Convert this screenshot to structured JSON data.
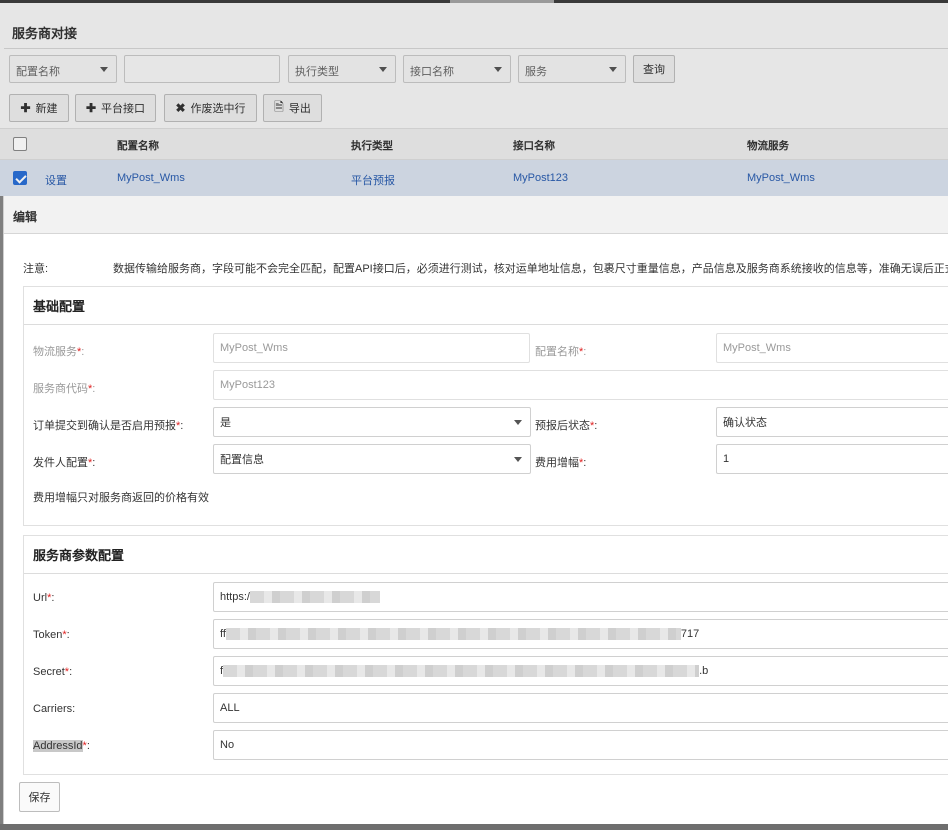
{
  "page": {
    "title": "服务商对接",
    "filters": {
      "config_name": "配置名称",
      "exec_type": "执行类型",
      "api_name": "接口名称",
      "service": "服务",
      "search_value": "",
      "query_label": "查询"
    },
    "toolbar": {
      "new_label": "新建",
      "platform_label": "平台接口",
      "void_label": "作废选中行",
      "export_label": "导出"
    },
    "table": {
      "headers": [
        "配置名称",
        "执行类型",
        "接口名称",
        "物流服务"
      ],
      "rows": [
        {
          "action": "设置",
          "config_name": "MyPost_Wms",
          "exec_type": "平台预报",
          "api_name": "MyPost123",
          "service": "MyPost_Wms"
        }
      ]
    }
  },
  "modal": {
    "title": "编辑",
    "notice_label": "注意:",
    "notice_text": "数据传输给服务商，字段可能不会完全匹配，配置API接口后，必须进行测试，核对运单地址信息，包裹尺寸重量信息，产品信息及服务商系统接收的信息等，准确无误后正式使",
    "basic": {
      "title": "基础配置",
      "logistics_service_label": "物流服务",
      "logistics_service_value": "MyPost_Wms",
      "config_name_label": "配置名称",
      "config_name_value": "MyPost_Wms",
      "provider_code_label": "服务商代码",
      "provider_code_value": "MyPost123",
      "enable_forecast_label": "订单提交到确认是否启用预报",
      "enable_forecast_value": "是",
      "post_forecast_status_label": "预报后状态",
      "post_forecast_status_value": "确认状态",
      "sender_config_label": "发件人配置",
      "sender_config_value": "配置信息",
      "fee_increase_label": "费用增幅",
      "fee_increase_value": "1",
      "fee_hint": "费用增幅只对服务商返回的价格有效"
    },
    "params": {
      "title": "服务商参数配置",
      "url_label": "Url",
      "url_prefix": "https:/",
      "token_label": "Token",
      "token_prefix": "ff",
      "token_suffix": "717",
      "secret_label": "Secret",
      "secret_prefix": "f",
      "secret_suffix": ".b",
      "carriers_label": "Carriers:",
      "carriers_value": "ALL",
      "addressid_label": "AddressId",
      "addressid_value": "No"
    },
    "save_label": "保存"
  },
  "colors": {
    "accent": "#2a5db0",
    "required": "#e02020",
    "selected_row": "#d9e2ee"
  }
}
